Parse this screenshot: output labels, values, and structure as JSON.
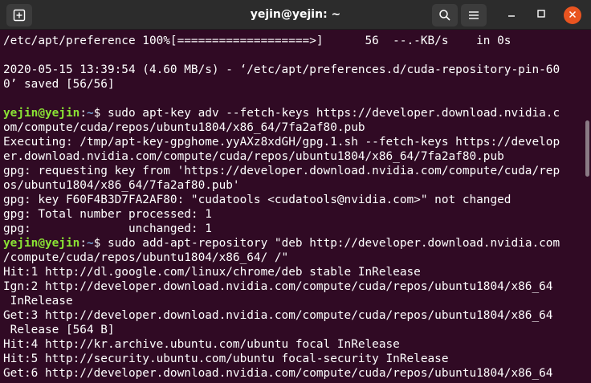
{
  "titlebar": {
    "title": "yejin@yejin: ~",
    "new_tab_icon": "new-tab-icon",
    "search_icon": "search-icon",
    "menu_icon": "hamburger-menu-icon",
    "minimize_icon": "minimize-icon",
    "maximize_icon": "maximize-icon",
    "close_icon": "close-icon",
    "close_color": "#e95420"
  },
  "terminal": {
    "background": "#300a24",
    "user_color": "#8ae234",
    "path_color": "#729fcf",
    "lines": [
      {
        "type": "text",
        "text": "/etc/apt/preference 100%[===================>]      56  --.-KB/s    in 0s"
      },
      {
        "type": "text",
        "text": ""
      },
      {
        "type": "text",
        "text": "2020-05-15 13:39:54 (4.60 MB/s) - ‘/etc/apt/preferences.d/cuda-repository-pin-60"
      },
      {
        "type": "text",
        "text": "0’ saved [56/56]"
      },
      {
        "type": "text",
        "text": ""
      },
      {
        "type": "prompt",
        "user": "yejin@yejin",
        "sep": ":",
        "path": "~",
        "symbol": "$ ",
        "cmd": "sudo apt-key adv --fetch-keys https://developer.download.nvidia.c"
      },
      {
        "type": "text",
        "text": "om/compute/cuda/repos/ubuntu1804/x86_64/7fa2af80.pub"
      },
      {
        "type": "text",
        "text": "Executing: /tmp/apt-key-gpghome.yyAXz8xdGH/gpg.1.sh --fetch-keys https://develop"
      },
      {
        "type": "text",
        "text": "er.download.nvidia.com/compute/cuda/repos/ubuntu1804/x86_64/7fa2af80.pub"
      },
      {
        "type": "text",
        "text": "gpg: requesting key from 'https://developer.download.nvidia.com/compute/cuda/rep"
      },
      {
        "type": "text",
        "text": "os/ubuntu1804/x86_64/7fa2af80.pub'"
      },
      {
        "type": "text",
        "text": "gpg: key F60F4B3D7FA2AF80: \"cudatools <cudatools@nvidia.com>\" not changed"
      },
      {
        "type": "text",
        "text": "gpg: Total number processed: 1"
      },
      {
        "type": "text",
        "text": "gpg:              unchanged: 1"
      },
      {
        "type": "prompt",
        "user": "yejin@yejin",
        "sep": ":",
        "path": "~",
        "symbol": "$ ",
        "cmd": "sudo add-apt-repository \"deb http://developer.download.nvidia.com"
      },
      {
        "type": "text",
        "text": "/compute/cuda/repos/ubuntu1804/x86_64/ /\""
      },
      {
        "type": "text",
        "text": "Hit:1 http://dl.google.com/linux/chrome/deb stable InRelease"
      },
      {
        "type": "text",
        "text": "Ign:2 http://developer.download.nvidia.com/compute/cuda/repos/ubuntu1804/x86_64"
      },
      {
        "type": "text",
        "text": " InRelease"
      },
      {
        "type": "text",
        "text": "Get:3 http://developer.download.nvidia.com/compute/cuda/repos/ubuntu1804/x86_64"
      },
      {
        "type": "text",
        "text": " Release [564 B]"
      },
      {
        "type": "text",
        "text": "Hit:4 http://kr.archive.ubuntu.com/ubuntu focal InRelease"
      },
      {
        "type": "text",
        "text": "Hit:5 http://security.ubuntu.com/ubuntu focal-security InRelease"
      },
      {
        "type": "text",
        "text": "Get:6 http://developer.download.nvidia.com/compute/cuda/repos/ubuntu1804/x86_64"
      }
    ]
  }
}
